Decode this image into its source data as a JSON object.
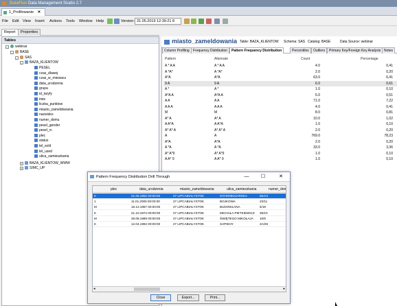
{
  "app": {
    "brand": "DataFlux",
    "title": " Data Management Studio 2.7"
  },
  "doc_tab": {
    "label": "1_Profilowanie",
    "close": "✕"
  },
  "menu": [
    "File",
    "Edit",
    "View",
    "Insert",
    "Actions",
    "Tools",
    "Window",
    "Help"
  ],
  "toolbar": {
    "version_label": "Version:",
    "version_value": "31.05.2019 12:39:21  8"
  },
  "left_tabs": [
    "Report",
    "Properties"
  ],
  "tables_header": "Tables",
  "tree": {
    "webinar": "webinar",
    "base": "BASE",
    "sas": "SAS",
    "baza": "BAZA_KLIENTOW",
    "columns": [
      "PESEL",
      "czas_dlawej",
      "czas_w_miesiacu",
      "data_urodzenia",
      "grupa",
      "id_taryfy",
      "imie",
      "liczba_punktow",
      "miasto_zameldowania",
      "nazwisko",
      "numer_domu",
      "pesel_gender",
      "pesel_rc",
      "plec",
      "status",
      "tel_sold",
      "tel_used",
      "ulica_zamieszkania"
    ],
    "baza_www": "BAZA_KLIENTOW_WWW",
    "simc": "SIMC_UP"
  },
  "header": {
    "title": "miasto_zameldowania",
    "table": "Table: BAZA_KLIENTOW",
    "schema": "Schema: SAS",
    "catalog": "Catalog: BASE",
    "datasource": "Data Source: webinar"
  },
  "inner_tabs": [
    "Column Profiling",
    "Frequency Distribution",
    "Pattern Frequency Distribution",
    "Percentiles",
    "Outliers",
    "Primary Key/Foreign Key Analysis",
    "Notes"
  ],
  "grid": {
    "headers": [
      "Pattern",
      "Alternate",
      "Count",
      "Percentage"
    ],
    "rows": [
      [
        "A * A A",
        "A * A A",
        "4.0",
        "0,41"
      ],
      [
        "A *A*",
        "A *A*",
        "2.0",
        "0,20"
      ],
      [
        "A*A",
        "A*A",
        "63.0",
        "6,41"
      ],
      [
        "9 A",
        "9 A",
        "6.0",
        "0,61"
      ],
      [
        "A *",
        "A *",
        "1.0",
        "0,10"
      ],
      [
        "A*A A",
        "A*A A",
        "5.0",
        "0,51"
      ],
      [
        "A A",
        "A A",
        "71.0",
        "7,22"
      ],
      [
        "A A A",
        "A A A",
        "4.0",
        "0,41"
      ],
      [
        "M",
        "M",
        "8.0",
        "0,81"
      ],
      [
        "A* A",
        "A* A",
        "10.0",
        "1,02"
      ],
      [
        "A A*A",
        "A A*A",
        "1.0",
        "0,10"
      ],
      [
        "A* A* A",
        "A* A* A",
        "2.0",
        "0,20"
      ],
      [
        "A",
        "A",
        "769.0",
        "78,23"
      ],
      [
        "A*A",
        "A*A",
        "2.0",
        "0,20"
      ],
      [
        "A *A",
        "A *A",
        "33.0",
        "3,36"
      ],
      [
        "A* A*9",
        "A* A*9",
        "1.0",
        "0,10"
      ],
      [
        "A A* 9",
        "A A* 9",
        "1.0",
        "0,10"
      ]
    ]
  },
  "dialog": {
    "title": "Pattern Frequency Distribution Drill Through",
    "headers": [
      "plec",
      "data_urodzenia",
      "miasto_zameldowania",
      "ulica_zamieszkania",
      "numer_domu"
    ],
    "rows": [
      [
        "0",
        "21.05.1952 00:00:00",
        "27 LIPCABIAŁYSTOK",
        "STAROBOJARSKA",
        "65A/4"
      ],
      [
        "1",
        "11.01.2008 00:00:00",
        "27 LIPCABIAŁYSTOK",
        "BOJKOWA",
        "23/11"
      ],
      [
        "M",
        "16.12.1967 00:00:00",
        "27 LIPCABIAŁYSTOK",
        "BUDOWLANA",
        "5/19"
      ],
      [
        "K",
        "21.10.1974 00:00:00",
        "27 LIPCABIAŁYSTOK",
        "MICHAŁA PIETKIEWICZ",
        "35/10"
      ],
      [
        "M",
        "28.08.1989 00:00:00",
        "27 LIPCABIAŁYSTOK",
        "ŚWIĘTEGO MIKOŁAJA",
        "10/6"
      ],
      [
        "K",
        "12.04.1994 00:00:00",
        "27 LIPCABIAŁYSTOK",
        "SAPIEHY",
        "2A/26"
      ]
    ],
    "buttons": {
      "close": "Close",
      "export": "Export...",
      "print": "Print..."
    },
    "minimize": "—",
    "maximize": "☐",
    "closex": "✕"
  },
  "colors": {
    "accent": "#2b4f86",
    "selection": "#1a6fd6"
  }
}
